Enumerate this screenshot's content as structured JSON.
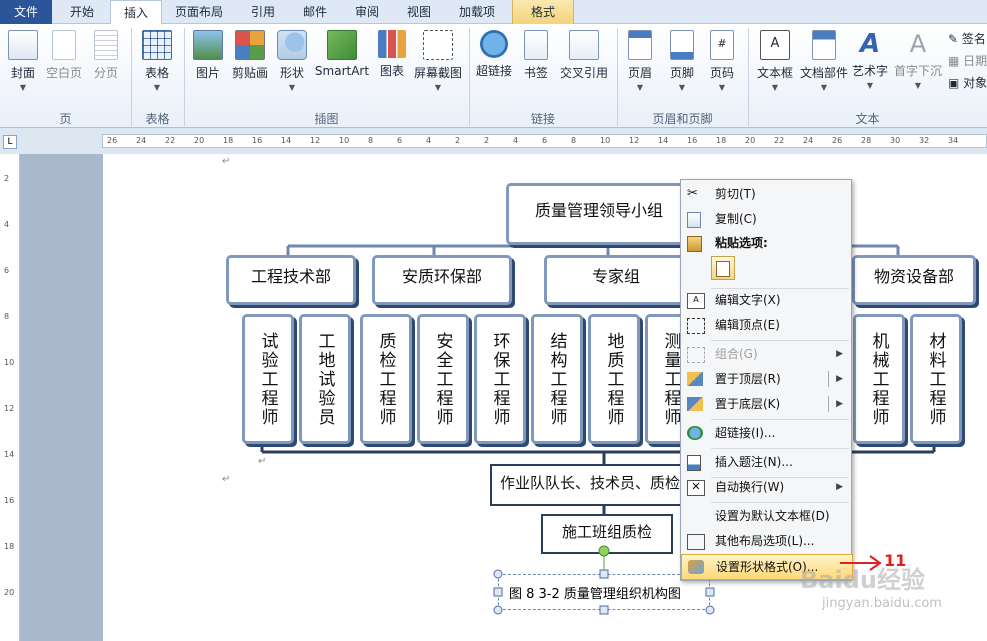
{
  "tabs": [
    {
      "label": "文件"
    },
    {
      "label": "开始"
    },
    {
      "label": "插入"
    },
    {
      "label": "页面布局"
    },
    {
      "label": "引用"
    },
    {
      "label": "邮件"
    },
    {
      "label": "审阅"
    },
    {
      "label": "视图"
    },
    {
      "label": "加载项"
    },
    {
      "label": "格式"
    }
  ],
  "ribbon": {
    "buttons": [
      {
        "label": "封面",
        "icon": "cover-page-icon"
      },
      {
        "label": "空白页",
        "icon": "blank-page-icon"
      },
      {
        "label": "分页",
        "icon": "page-break-icon"
      },
      {
        "label": "表格",
        "icon": "table-icon"
      },
      {
        "label": "图片",
        "icon": "picture-icon"
      },
      {
        "label": "剪贴画",
        "icon": "clipart-icon"
      },
      {
        "label": "形状",
        "icon": "shapes-icon"
      },
      {
        "label": "SmartArt",
        "icon": "smartart-icon"
      },
      {
        "label": "图表",
        "icon": "chart-icon"
      },
      {
        "label": "屏幕截图",
        "icon": "screenshot-icon"
      },
      {
        "label": "超链接",
        "icon": "hyperlink-icon"
      },
      {
        "label": "书签",
        "icon": "bookmark-icon"
      },
      {
        "label": "交叉引用",
        "icon": "cross-reference-icon"
      },
      {
        "label": "页眉",
        "icon": "header-icon"
      },
      {
        "label": "页脚",
        "icon": "footer-icon"
      },
      {
        "label": "页码",
        "icon": "page-number-icon"
      },
      {
        "label": "文本框",
        "icon": "textbox-icon"
      },
      {
        "label": "文档部件",
        "icon": "quick-parts-icon"
      },
      {
        "label": "艺术字",
        "icon": "wordart-icon"
      },
      {
        "label": "首字下沉",
        "icon": "drop-cap-icon"
      }
    ],
    "small_buttons": [
      {
        "label": "签名"
      },
      {
        "label": "日期"
      },
      {
        "label": "对象"
      }
    ],
    "groups": [
      {
        "label": "页"
      },
      {
        "label": "表格"
      },
      {
        "label": "插图"
      },
      {
        "label": "链接"
      },
      {
        "label": "页眉和页脚"
      },
      {
        "label": "文本"
      }
    ]
  },
  "ruler": {
    "h_ticks": [
      "26",
      "24",
      "22",
      "20",
      "18",
      "16",
      "14",
      "12",
      "10",
      "8",
      "6",
      "4",
      "2",
      "2",
      "4",
      "6",
      "8",
      "10",
      "12",
      "14",
      "16",
      "18",
      "20",
      "22",
      "24",
      "26",
      "28",
      "30",
      "32",
      "34"
    ],
    "v_ticks": [
      "2",
      "4",
      "6",
      "8",
      "10",
      "12",
      "14",
      "16",
      "18",
      "20"
    ],
    "corner": "L"
  },
  "document": {
    "org_chart": {
      "top": "质量管理领导小组",
      "departments": [
        "工程技术部",
        "安质环保部",
        "专家组",
        "物资设备部"
      ],
      "roles": [
        "试验工程师",
        "工地试验员",
        "质检工程师",
        "安全工程师",
        "环保工程师",
        "结构工程师",
        "地质工程师",
        "测量工程师",
        "机械工程师",
        "材料工程师"
      ],
      "team_box": "作业队队长、技术员、质检",
      "crew_box": "施工班组质检",
      "caption": "图 8 3-2 质量管理组织机构图"
    },
    "paragraph_mark": "↵"
  },
  "context_menu": {
    "items": [
      {
        "label": "剪切(T)",
        "icon": "scissors-icon"
      },
      {
        "label": "复制(C)",
        "icon": "copy-icon"
      },
      {
        "label": "粘贴选项:",
        "icon": "paste-icon"
      },
      {
        "label": "编辑文字(X)",
        "icon": "edit-text-icon"
      },
      {
        "label": "编辑顶点(E)",
        "icon": "edit-points-icon"
      },
      {
        "label": "组合(G)",
        "icon": "group-icon"
      },
      {
        "label": "置于顶层(R)",
        "icon": "bring-front-icon"
      },
      {
        "label": "置于底层(K)",
        "icon": "send-back-icon"
      },
      {
        "label": "超链接(I)...",
        "icon": "hyperlink-icon"
      },
      {
        "label": "插入题注(N)...",
        "icon": "caption-icon"
      },
      {
        "label": "自动换行(W)",
        "icon": "wrap-icon"
      },
      {
        "label": "设置为默认文本框(D)",
        "icon": ""
      },
      {
        "label": "其他布局选项(L)...",
        "icon": "layout-icon"
      },
      {
        "label": "设置形状格式(O)...",
        "icon": "format-shape-icon"
      }
    ]
  },
  "annotation": {
    "label": "11",
    "color": "#e02020"
  },
  "watermark": {
    "text": "Baidu经验",
    "url": "jingyan.baidu.com"
  },
  "colors": {
    "file_tab": "#2a5699",
    "box_border": "#7f98bb",
    "box_shadow": "#2e4a74",
    "highlight": "#ffd877"
  }
}
